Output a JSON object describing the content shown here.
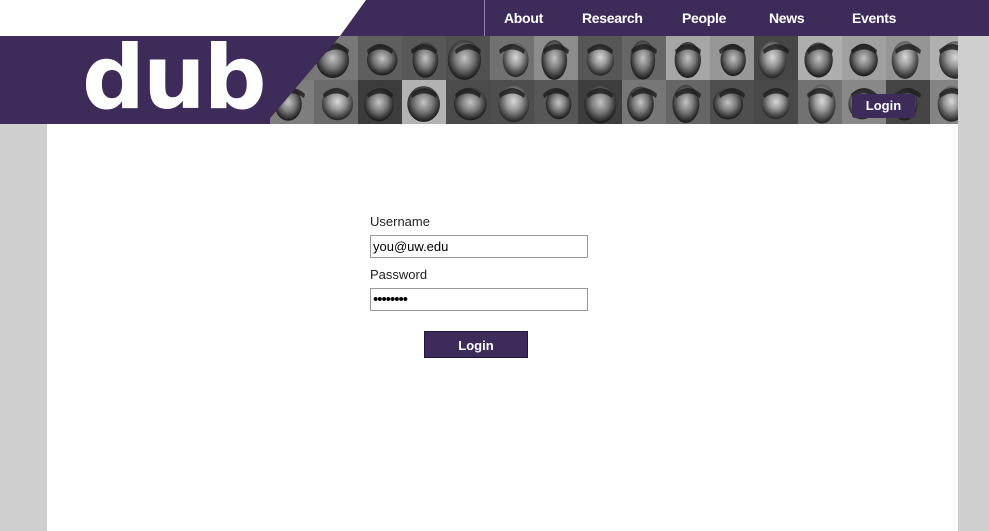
{
  "nav": {
    "items": [
      {
        "label": "About"
      },
      {
        "label": "Research"
      },
      {
        "label": "People"
      },
      {
        "label": "News"
      },
      {
        "label": "Events"
      }
    ]
  },
  "header": {
    "logo": "dub",
    "login_label": "Login"
  },
  "login_form": {
    "username_label": "Username",
    "username_value": "you@uw.edu",
    "password_label": "Password",
    "password_value": "••••••••",
    "submit_label": "Login"
  },
  "colors": {
    "brand_purple": "#3d2b5a",
    "page_gray": "#cfcfcf"
  }
}
